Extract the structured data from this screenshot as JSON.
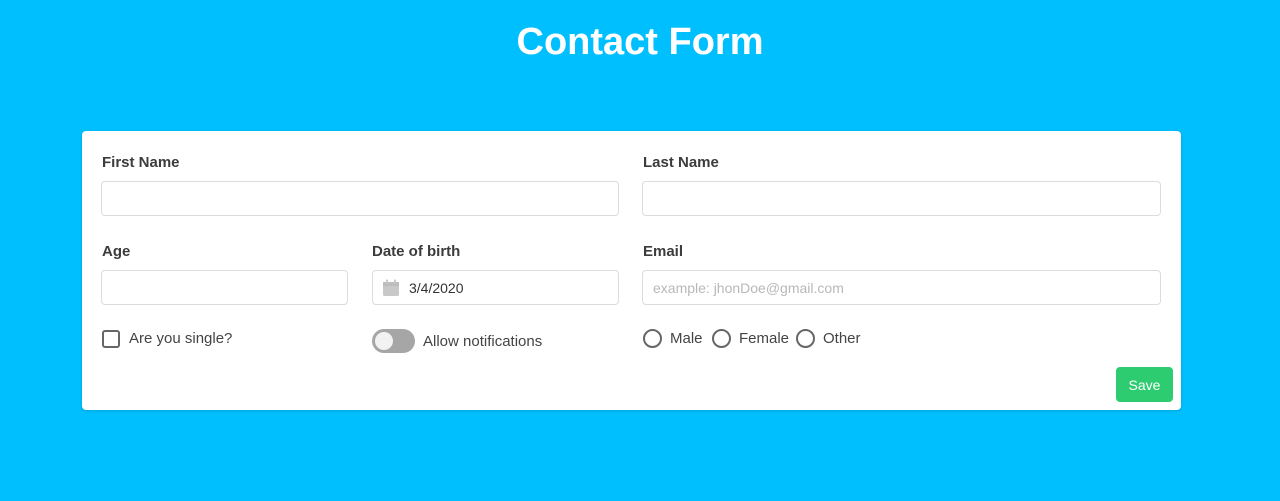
{
  "header": {
    "title": "Contact Form"
  },
  "form": {
    "first_name": {
      "label": "First Name",
      "value": ""
    },
    "last_name": {
      "label": "Last Name",
      "value": ""
    },
    "age": {
      "label": "Age",
      "value": ""
    },
    "date_of_birth": {
      "label": "Date of birth",
      "value": "3/4/2020",
      "icon": "calendar-icon"
    },
    "email": {
      "label": "Email",
      "value": "",
      "placeholder": "example: jhonDoe@gmail.com"
    },
    "single": {
      "label": "Are you single?",
      "checked": false
    },
    "notifications": {
      "label": "Allow notifications",
      "enabled": false
    },
    "gender": {
      "options": [
        "Male",
        "Female",
        "Other"
      ],
      "selected": null
    },
    "save_label": "Save"
  },
  "colors": {
    "background": "#00bfff",
    "save_button": "#2ecc71",
    "toggle_off": "#a6a6a6"
  }
}
